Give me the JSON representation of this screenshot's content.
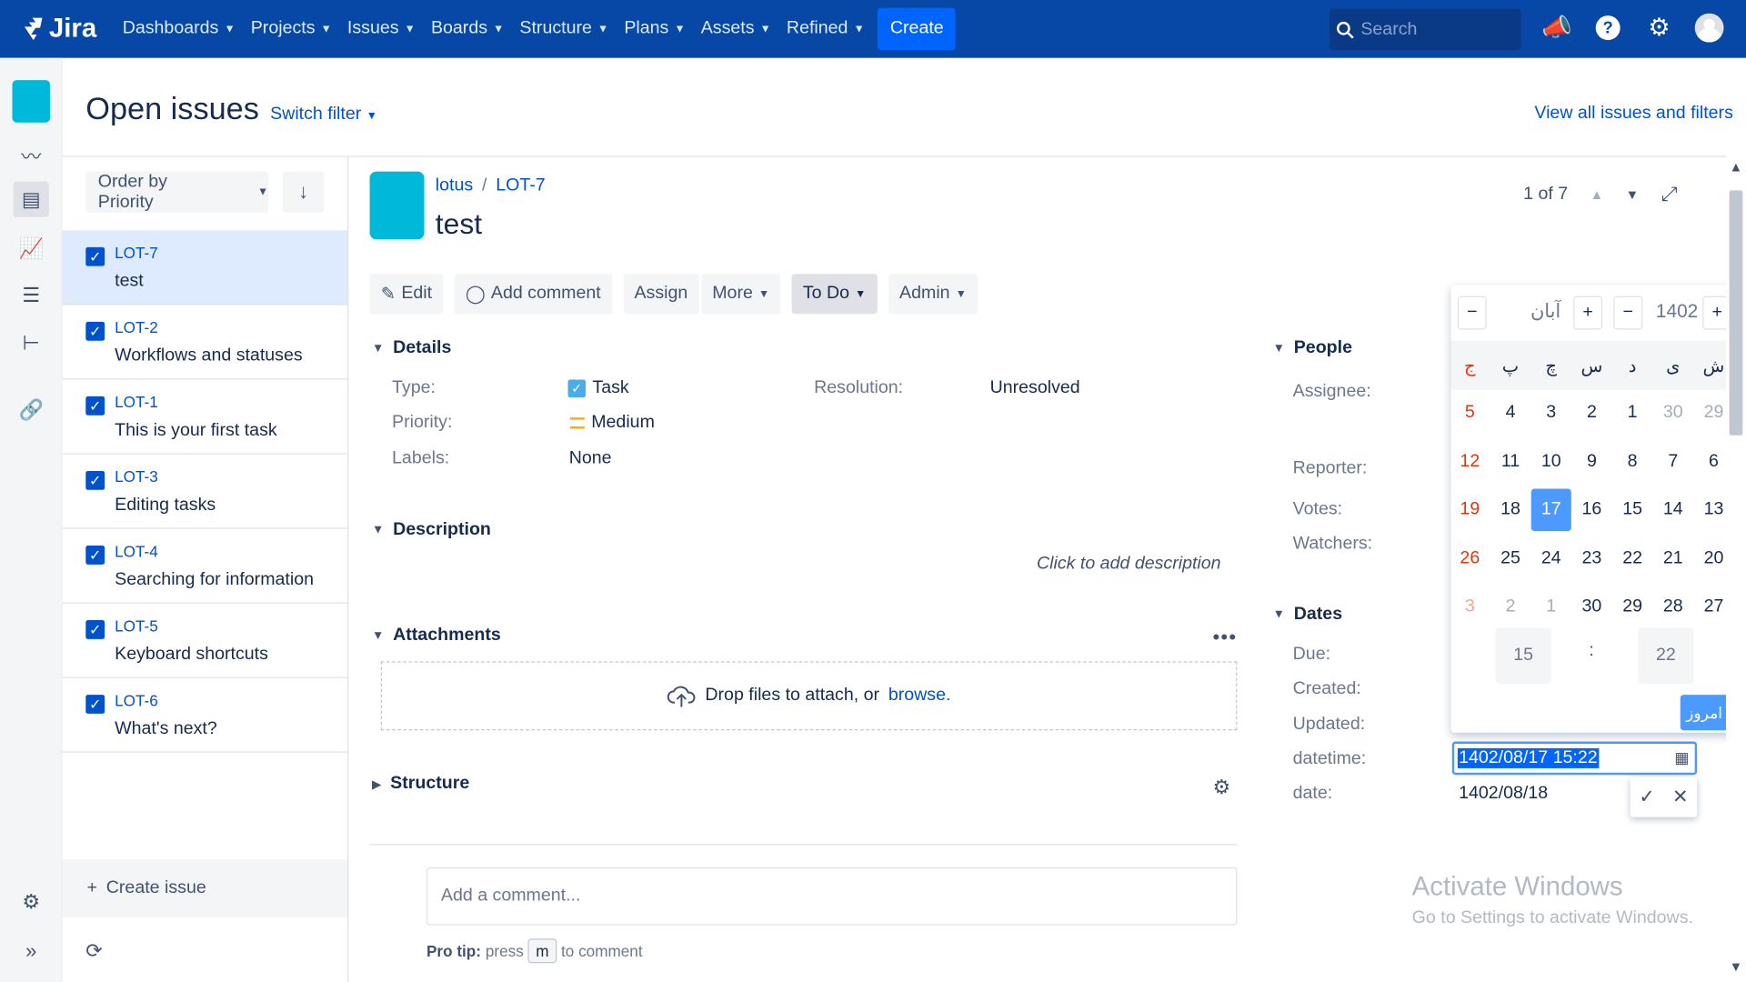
{
  "nav": {
    "logo": "Jira",
    "items": [
      "Dashboards",
      "Projects",
      "Issues",
      "Boards",
      "Structure",
      "Plans",
      "Assets",
      "Refined"
    ],
    "create": "Create",
    "search_placeholder": "Search"
  },
  "header": {
    "title": "Open issues",
    "switch_filter": "Switch filter",
    "view_all": "View all issues and filters"
  },
  "list": {
    "order_by": "Order by Priority",
    "items": [
      {
        "key": "LOT-7",
        "summary": "test"
      },
      {
        "key": "LOT-2",
        "summary": "Workflows and statuses"
      },
      {
        "key": "LOT-1",
        "summary": "This is your first task"
      },
      {
        "key": "LOT-3",
        "summary": "Editing tasks"
      },
      {
        "key": "LOT-4",
        "summary": "Searching for information"
      },
      {
        "key": "LOT-5",
        "summary": "Keyboard shortcuts"
      },
      {
        "key": "LOT-6",
        "summary": "What's next?"
      }
    ],
    "create_issue": "Create issue"
  },
  "issue": {
    "project": "lotus",
    "key": "LOT-7",
    "title": "test",
    "pager": "1 of 7",
    "actions": {
      "edit": "Edit",
      "add_comment": "Add comment",
      "assign": "Assign",
      "more": "More",
      "status": "To Do",
      "admin": "Admin"
    },
    "details": {
      "heading": "Details",
      "type_label": "Type:",
      "type_value": "Task",
      "priority_label": "Priority:",
      "priority_value": "Medium",
      "labels_label": "Labels:",
      "labels_value": "None",
      "resolution_label": "Resolution:",
      "resolution_value": "Unresolved"
    },
    "description": {
      "heading": "Description",
      "placeholder": "Click to add description"
    },
    "attachments": {
      "heading": "Attachments",
      "drop_text": "Drop files to attach, or",
      "browse": "browse."
    },
    "structure": {
      "heading": "Structure"
    },
    "comment": {
      "placeholder": "Add a comment...",
      "protip_label": "Pro tip:",
      "protip_press": "press",
      "protip_key": "m",
      "protip_suffix": "to comment"
    }
  },
  "people": {
    "heading": "People",
    "assignee": "Assignee:",
    "reporter": "Reporter:",
    "votes": "Votes:",
    "watchers": "Watchers:"
  },
  "dates": {
    "heading": "Dates",
    "due": "Due:",
    "created": "Created:",
    "updated": "Updated:",
    "datetime_label": "datetime:",
    "datetime_value": "1402/08/17 15:22",
    "date_label": "date:",
    "date_value": "1402/08/18"
  },
  "calendar": {
    "month": "آبان",
    "year": "1402",
    "weekdays": [
      "ش",
      "ی",
      "د",
      "س",
      "چ",
      "پ",
      "ج"
    ],
    "weeks": [
      [
        "29",
        "30",
        "1",
        "2",
        "3",
        "4",
        "5"
      ],
      [
        "6",
        "7",
        "8",
        "9",
        "10",
        "11",
        "12"
      ],
      [
        "13",
        "14",
        "15",
        "16",
        "17",
        "18",
        "19"
      ],
      [
        "20",
        "21",
        "22",
        "23",
        "24",
        "25",
        "26"
      ],
      [
        "27",
        "28",
        "29",
        "30",
        "1",
        "2",
        "3"
      ]
    ],
    "selected_day": "17",
    "hour": "15",
    "minute": "22",
    "time_separator": ":",
    "today": "امروز"
  },
  "watermark": {
    "line1": "Activate Windows",
    "line2": "Go to Settings to activate Windows."
  },
  "colors": {
    "nav_bg": "#0747a6",
    "accent": "#0052cc",
    "create": "#0065ff",
    "holiday": "#de350b",
    "selected": "#4c9aff"
  }
}
